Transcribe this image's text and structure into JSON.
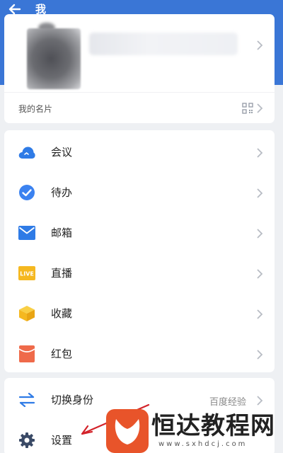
{
  "header": {
    "title": "我",
    "back_icon": "arrow-left-icon"
  },
  "profile": {
    "name_card_label": "我的名片",
    "qr_icon": "qr-code-icon"
  },
  "menu": {
    "items": [
      {
        "label": "会议",
        "icon": "cloud-meeting-icon",
        "color": "#2f7be6"
      },
      {
        "label": "待办",
        "icon": "check-circle-icon",
        "color": "#3b82f0"
      },
      {
        "label": "邮箱",
        "icon": "mail-icon",
        "color": "#2f7be6"
      },
      {
        "label": "直播",
        "icon": "live-icon",
        "color": "#f5b820",
        "badge": "LIVE"
      },
      {
        "label": "收藏",
        "icon": "box-icon",
        "color": "#f5b820"
      },
      {
        "label": "红包",
        "icon": "red-envelope-icon",
        "color": "#ef6a4a"
      }
    ]
  },
  "bottom": {
    "items": [
      {
        "label": "切换身份",
        "value": "百度经验",
        "icon": "switch-arrows-icon",
        "color": "#2f7be6"
      },
      {
        "label": "设置",
        "icon": "gear-icon",
        "color": "#3a4a66"
      }
    ]
  },
  "watermark": {
    "text": "恒达教程网",
    "url": "www.sxhdcj.com"
  },
  "colors": {
    "brand": "#3a76d6",
    "annotation": "#d3232a",
    "logo": "#e8542a"
  }
}
